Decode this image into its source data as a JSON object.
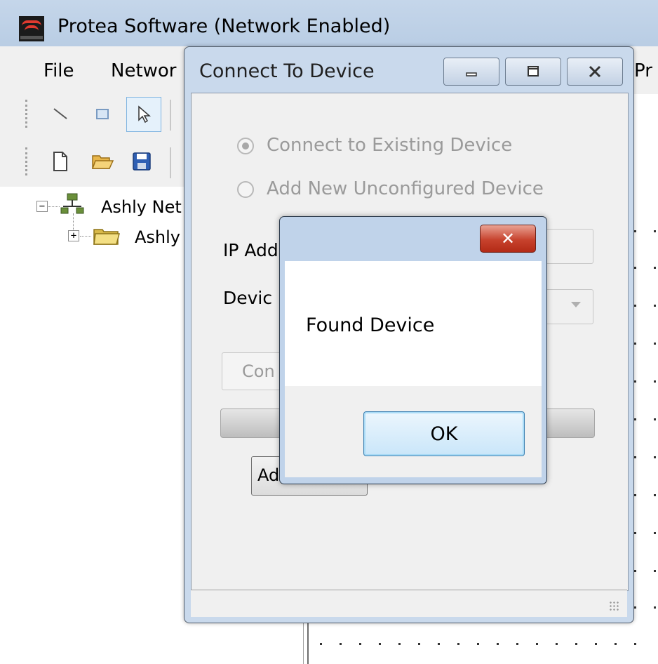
{
  "app": {
    "title": "Protea Software (Network Enabled)",
    "icon": "ashly-logo-icon"
  },
  "menu": {
    "items": [
      "File",
      "Networ",
      "Pr"
    ]
  },
  "tree": {
    "root_label": "Ashly Net",
    "child_label": "Ashly"
  },
  "connect_dialog": {
    "title": "Connect To Device",
    "radio_existing": "Connect to Existing Device",
    "radio_new": "Add New Unconfigured Device",
    "ip_label": "IP Add",
    "device_label": "Devic",
    "connect_button": "Con",
    "add_button": "Ad"
  },
  "message_box": {
    "message": "Found Device",
    "ok_label": "OK",
    "close_label": "✕"
  },
  "colors": {
    "titlebar": "#c5d6ea",
    "dialog_frame": "#c9d9ec",
    "close_red": "#c7422d",
    "ok_blue": "#c9e6f9"
  }
}
